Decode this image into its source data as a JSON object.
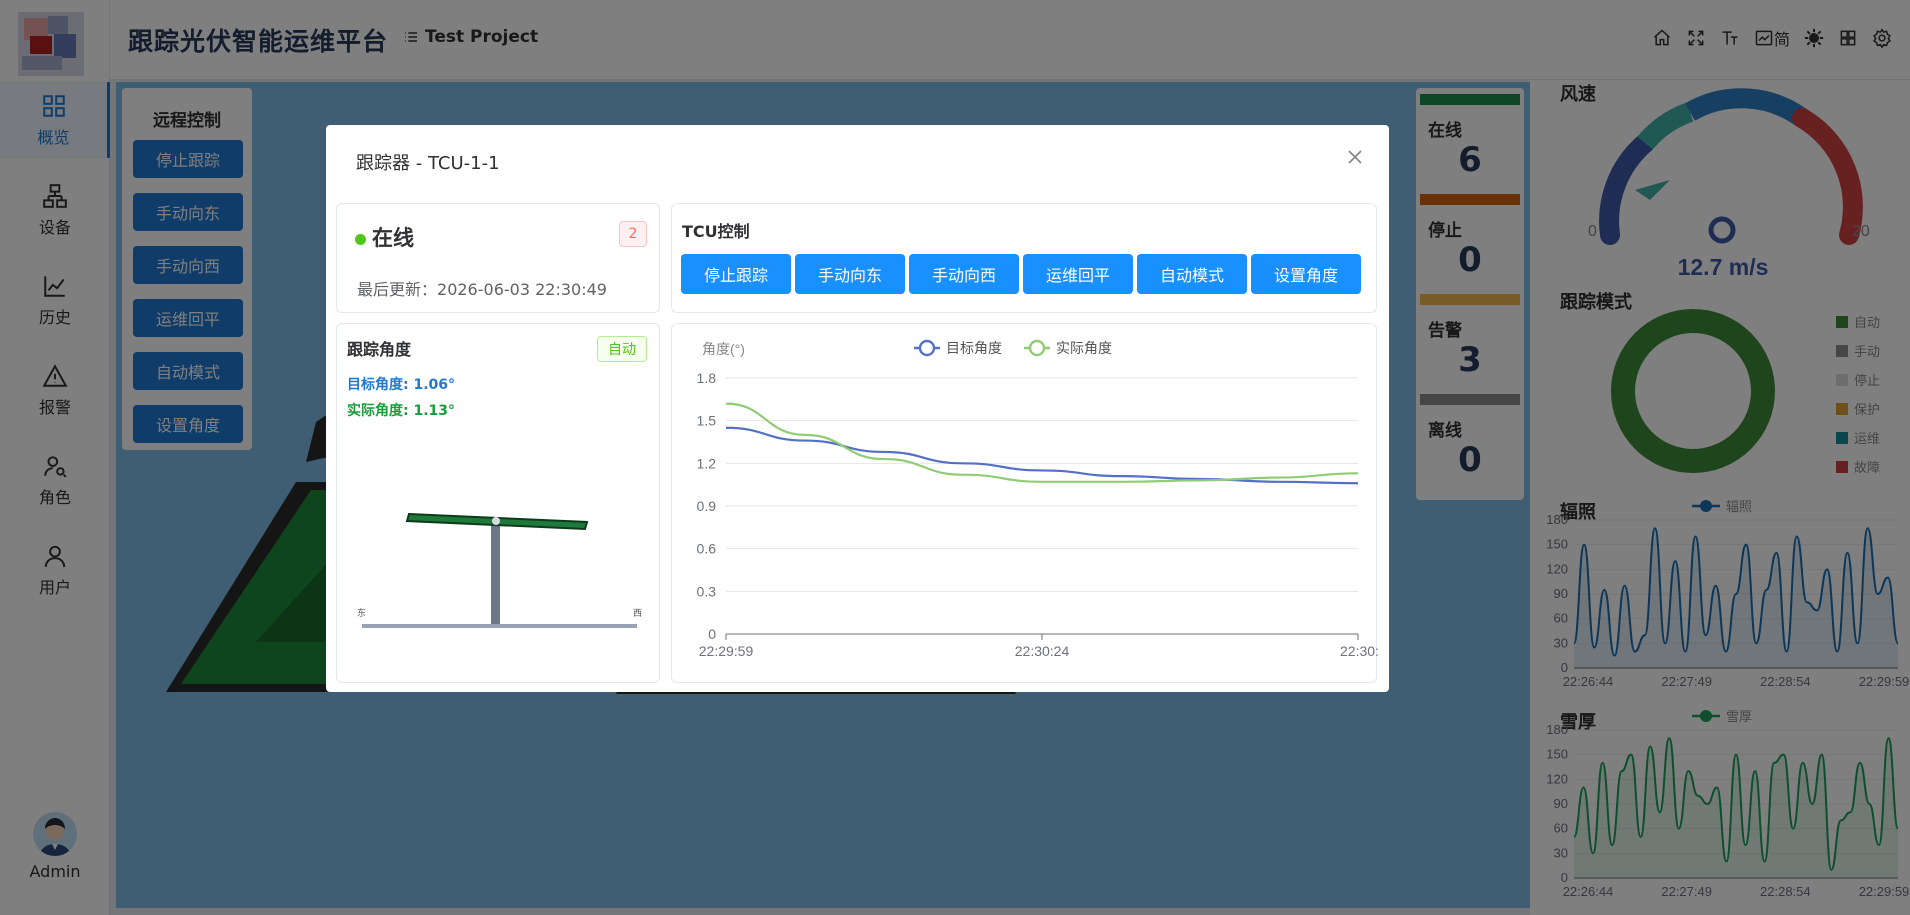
{
  "app": {
    "title": "跟踪光伏智能运维平台",
    "project": "Test Project"
  },
  "header_icons": [
    {
      "icon": "home-icon"
    },
    {
      "icon": "fullscreen-icon"
    },
    {
      "icon": "font-size-icon"
    },
    {
      "icon": "language-icon",
      "label": "简"
    },
    {
      "icon": "theme-icon"
    },
    {
      "icon": "apps-icon"
    },
    {
      "icon": "settings-icon"
    }
  ],
  "nav": [
    {
      "label": "概览",
      "icon": "dashboard-icon",
      "active": true
    },
    {
      "label": "设备",
      "icon": "device-icon"
    },
    {
      "label": "历史",
      "icon": "history-chart-icon"
    },
    {
      "label": "报警",
      "icon": "warning-icon"
    },
    {
      "label": "角色",
      "icon": "role-icon"
    },
    {
      "label": "用户",
      "icon": "user-icon"
    }
  ],
  "user": {
    "name": "Admin"
  },
  "remote_control": {
    "title": "远程控制",
    "buttons": [
      "停止跟踪",
      "手动向东",
      "手动向西",
      "运维回平",
      "自动模式",
      "设置角度"
    ]
  },
  "status_counts": [
    {
      "label": "在线",
      "value": "6",
      "color": "#1a8f4a"
    },
    {
      "label": "停止",
      "value": "0",
      "color": "#d4600e"
    },
    {
      "label": "告警",
      "value": "3",
      "color": "#f0b94a"
    },
    {
      "label": "离线",
      "value": "0",
      "color": "#8c8c8c"
    }
  ],
  "wind": {
    "title": "风速",
    "value": "12.7 m/s",
    "min_label": "0",
    "max_label": "20"
  },
  "track_mode": {
    "title": "跟踪模式",
    "legend": [
      {
        "label": "自动",
        "color": "#3f8a3a"
      },
      {
        "label": "手动",
        "color": "#8c8c8c"
      },
      {
        "label": "停止",
        "color": "#dadada"
      },
      {
        "label": "保护",
        "color": "#e0a030"
      },
      {
        "label": "运维",
        "color": "#14909a"
      },
      {
        "label": "故障",
        "color": "#d14343"
      }
    ]
  },
  "irradiance": {
    "title": "辐照",
    "legend": "辐照"
  },
  "snow": {
    "title": "雪厚",
    "legend": "雪厚"
  },
  "modal": {
    "title": "跟踪器 - TCU-1-1",
    "status_text": "在线",
    "badge": "2",
    "last_update_label": "最后更新：",
    "last_update": "2026-06-03 22:30:49",
    "tcu_title": "TCU控制",
    "tcu_buttons": [
      "停止跟踪",
      "手动向东",
      "手动向西",
      "运维回平",
      "自动模式",
      "设置角度"
    ],
    "angle_title": "跟踪角度",
    "angle_tag": "自动",
    "target_label": "目标角度",
    "target_value": ": 1.06°",
    "actual_label": "实际角度",
    "actual_value": ": 1.13°",
    "east_label": "东",
    "west_label": "西"
  },
  "chart_data": [
    {
      "type": "line",
      "ylabel": "角度(°)",
      "xlabel": "",
      "x": [
        "22:29:59",
        "22:30:05",
        "22:30:11",
        "22:30:18",
        "22:30:24",
        "22:30:30",
        "22:30:37",
        "22:30:43",
        "22:30:49"
      ],
      "x_tick_labels": [
        "22:29:59",
        "22:30:24",
        "22:30:"
      ],
      "ylim": [
        0,
        1.8
      ],
      "y_ticks": [
        0,
        0.3,
        0.6,
        0.9,
        1.2,
        1.5,
        1.8
      ],
      "grid": true,
      "legend_position": "top-center",
      "series": [
        {
          "name": "目标角度",
          "color": "#5470c6",
          "values": [
            1.45,
            1.36,
            1.28,
            1.2,
            1.15,
            1.11,
            1.09,
            1.07,
            1.06
          ]
        },
        {
          "name": "实际角度",
          "color": "#91cc75",
          "values": [
            1.62,
            1.4,
            1.23,
            1.12,
            1.07,
            1.07,
            1.08,
            1.1,
            1.13
          ]
        }
      ]
    },
    {
      "type": "line",
      "title": "辐照",
      "ylim": [
        0,
        180
      ],
      "y_ticks": [
        0,
        30,
        60,
        90,
        120,
        150,
        180
      ],
      "x_tick_labels": [
        "22:26:44",
        "22:27:49",
        "22:28:54",
        "22:29:59"
      ],
      "legend_position": "top-center",
      "series": [
        {
          "name": "辐照",
          "color": "#1a6fb0",
          "values": [
            30,
            150,
            25,
            95,
            15,
            100,
            20,
            40,
            170,
            30,
            130,
            20,
            160,
            40,
            100,
            20,
            90,
            150,
            30,
            95,
            140,
            20,
            160,
            80,
            70,
            120,
            20,
            140,
            30,
            170,
            90,
            110,
            30
          ]
        }
      ]
    },
    {
      "type": "line",
      "title": "雪厚",
      "ylim": [
        0,
        180
      ],
      "y_ticks": [
        0,
        30,
        60,
        90,
        120,
        150,
        180
      ],
      "x_tick_labels": [
        "22:26:44",
        "22:27:49",
        "22:28:54",
        "22:29:59"
      ],
      "legend_position": "top-center",
      "series": [
        {
          "name": "雪厚",
          "color": "#1a9e5c",
          "values": [
            50,
            110,
            30,
            140,
            40,
            130,
            150,
            50,
            160,
            80,
            170,
            60,
            130,
            100,
            90,
            110,
            20,
            150,
            40,
            130,
            20,
            140,
            150,
            60,
            140,
            90,
            150,
            10,
            70,
            80,
            140,
            90,
            40,
            170,
            60
          ]
        }
      ]
    }
  ]
}
